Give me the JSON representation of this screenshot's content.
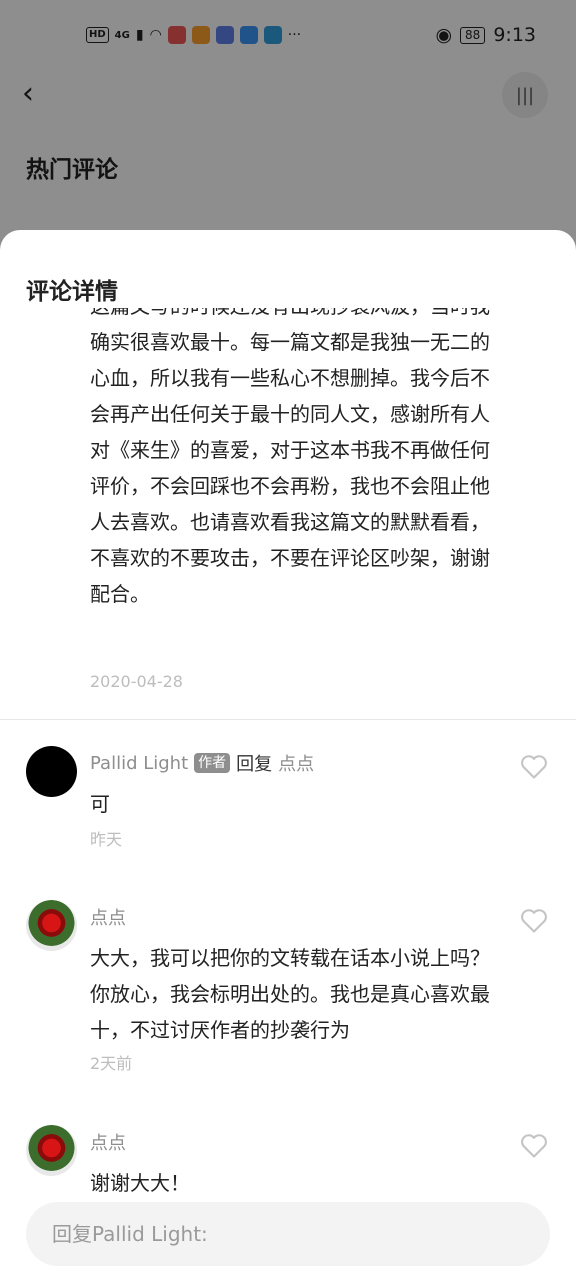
{
  "status_bar": {
    "left": {
      "hd": "HD",
      "signal": "4G",
      "dots": "···"
    },
    "time": "9:13",
    "battery": "88"
  },
  "background": {
    "back_icon": "chevron-left-icon",
    "audio_icon": "audio-icon",
    "title": "热门评论"
  },
  "sheet": {
    "title": "评论详情",
    "main_comment": {
      "text": "这篇文写的时候还没有出现抄袭风波，当时我确实很喜欢最十。每一篇文都是我独一无二的心血，所以我有一些私心不想删掉。我今后不会再产出任何关于最十的同人文，感谢所有人对《来生》的喜爱，对于这本书我不再做任何评价，不会回踩也不会再粉，我也不会阻止他人去喜欢。也请喜欢看我这篇文的默默看看，不喜欢的不要攻击，不要在评论区吵架，谢谢配合。",
      "date": "2020-04-28"
    },
    "replies": [
      {
        "name": "Pallid Light",
        "tag": "作者",
        "reply_word": "回复",
        "target": "点点",
        "text": "可",
        "time": "昨天",
        "avatar": "black"
      },
      {
        "name": "点点",
        "text": "大大，我可以把你的文转载在话本小说上吗？你放心，我会标明出处的。我也是真心喜欢最十，不过讨厌作者的抄袭行为",
        "time": "2天前",
        "avatar": "rose"
      },
      {
        "name": "点点",
        "text": "谢谢大大！",
        "avatar": "rose"
      }
    ],
    "reply_input": {
      "placeholder": "回复Pallid Light:"
    }
  }
}
